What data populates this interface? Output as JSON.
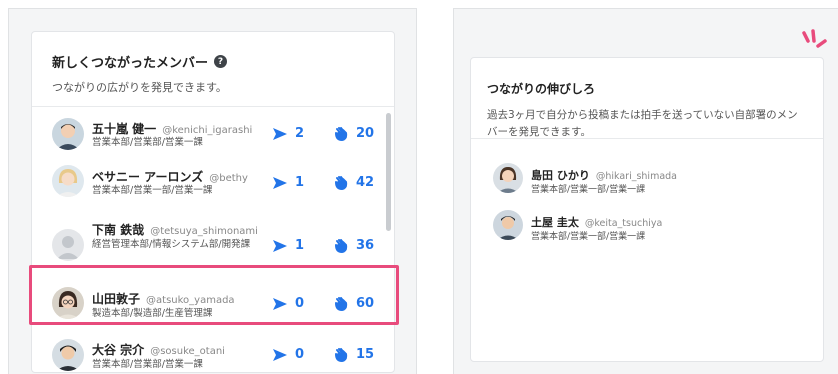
{
  "left_card": {
    "title": "新しくつながったメンバー",
    "help": "?",
    "subtitle": "つながりの広がりを発見できます。",
    "members": [
      {
        "name": "五十嵐 健一",
        "handle": "@kenichi_igarashi",
        "dept": "営業本部/営業部/営業一課",
        "posts": "2",
        "claps": "20",
        "avatar": "man-short-hair"
      },
      {
        "name": "ベサニー アーロンズ",
        "handle": "@bethy",
        "dept": "営業本部/営業一部/営業一課",
        "posts": "1",
        "claps": "42",
        "avatar": "woman-blonde"
      },
      {
        "name": "下南 鉄哉",
        "handle": "@tetsuya_shimonami",
        "dept": "経営管理本部/情報システム部/開発課",
        "posts": "1",
        "claps": "36",
        "avatar": "default-user"
      },
      {
        "name": "山田敦子",
        "handle": "@atsuko_yamada",
        "dept": "製造本部/製造部/生産管理課",
        "posts": "0",
        "claps": "60",
        "avatar": "woman-glasses"
      },
      {
        "name": "大谷 宗介",
        "handle": "@sosuke_otani",
        "dept": "営業本部/営業部/営業一課",
        "posts": "0",
        "claps": "15",
        "avatar": "man-dark-hair"
      }
    ]
  },
  "right_card": {
    "title": "つながりの伸びしろ",
    "subtitle": "過去3ヶ月で自分から投稿または拍手を送っていない自部署のメンバーを発見できます。",
    "members": [
      {
        "name": "島田 ひかり",
        "handle": "@hikari_shimada",
        "dept": "営業本部/営業一部/営業一課",
        "avatar": "woman-short-hair"
      },
      {
        "name": "土屋 圭太",
        "handle": "@keita_tsuchiya",
        "dept": "営業本部/営業一部/営業一課",
        "avatar": "man-short-hair"
      }
    ]
  },
  "colors": {
    "accent": "#2274e8",
    "highlight": "#e84b7c",
    "sparkle": "#e84b7c"
  },
  "icons": {
    "posts": "send-icon",
    "claps": "clap-icon",
    "help": "help-icon"
  }
}
